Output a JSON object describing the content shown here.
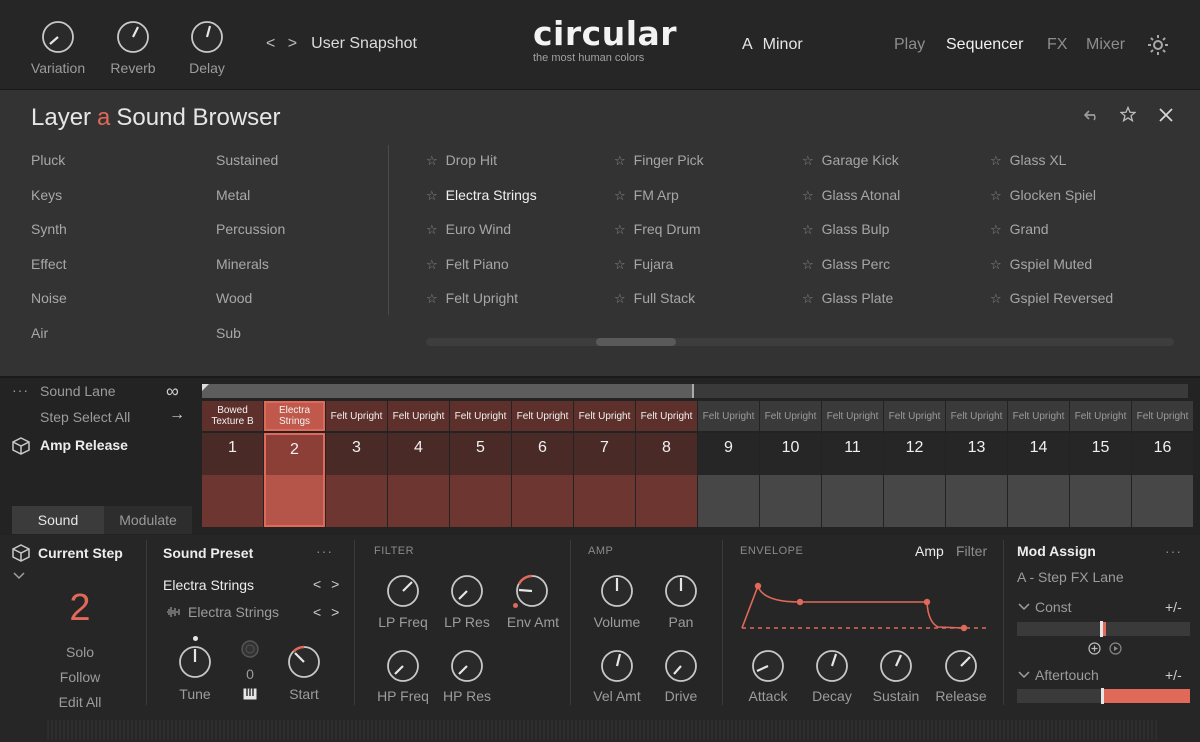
{
  "top": {
    "knobs": [
      {
        "label": "Variation"
      },
      {
        "label": "Reverb"
      },
      {
        "label": "Delay"
      }
    ],
    "snapshot_nav": "< >",
    "snapshot": "User Snapshot",
    "brand": "circular",
    "brand_sub": "the most human colors",
    "key_root": "A",
    "key_mode": "Minor",
    "nav": [
      "Play",
      "Sequencer",
      "FX",
      "Mixer"
    ],
    "nav_active": "Sequencer"
  },
  "browser": {
    "title_layer": "Layer",
    "title_a": "a",
    "title_rest": "Sound Browser",
    "categories_col1": [
      "Pluck",
      "Keys",
      "Synth",
      "Effect",
      "Noise",
      "Air"
    ],
    "categories_col2": [
      "Sustained",
      "Metal",
      "Percussion",
      "Minerals",
      "Wood",
      "Sub"
    ],
    "presets": [
      [
        "Drop Hit",
        "Electra Strings",
        "Euro Wind",
        "Felt Piano",
        "Felt Upright"
      ],
      [
        "Finger Pick",
        "FM Arp",
        "Freq Drum",
        "Fujara",
        "Full Stack"
      ],
      [
        "Garage Kick",
        "Glass Atonal",
        "Glass Bulp",
        "Glass Perc",
        "Glass Plate"
      ],
      [
        "Glass XL",
        "Glocken Spiel",
        "Grand",
        "Gspiel Muted",
        "Gspiel Reversed"
      ]
    ],
    "selected_preset": "Electra Strings",
    "star": "☆"
  },
  "sequencer": {
    "sound_lane": "Sound Lane",
    "step_select": "Step Select",
    "step_select_all": "All",
    "lane_name": "Amp Release",
    "dots": "···",
    "infinity": "∞",
    "arrow": "→",
    "steps": [
      {
        "num": "1",
        "sound": "Bowed Texture B",
        "level": 1.0,
        "active": true
      },
      {
        "num": "2",
        "sound": "Electra Strings",
        "level": 0.7,
        "active": true,
        "selected": true
      },
      {
        "num": "3",
        "sound": "Felt Upright",
        "level": 1.0,
        "active": true
      },
      {
        "num": "4",
        "sound": "Felt Upright",
        "level": 1.0,
        "active": true
      },
      {
        "num": "5",
        "sound": "Felt Upright",
        "level": 1.0,
        "active": true
      },
      {
        "num": "6",
        "sound": "Felt Upright",
        "level": 1.0,
        "active": true
      },
      {
        "num": "7",
        "sound": "Felt Upright",
        "level": 1.0,
        "active": true
      },
      {
        "num": "8",
        "sound": "Felt Upright",
        "level": 1.0,
        "active": true
      },
      {
        "num": "9",
        "sound": "Felt Upright",
        "level": 1.0,
        "active": false
      },
      {
        "num": "10",
        "sound": "Felt Upright",
        "level": 1.0,
        "active": false
      },
      {
        "num": "11",
        "sound": "Felt Upright",
        "level": 1.0,
        "active": false
      },
      {
        "num": "12",
        "sound": "Felt Upright",
        "level": 1.0,
        "active": false
      },
      {
        "num": "13",
        "sound": "Felt Upright",
        "level": 1.0,
        "active": false
      },
      {
        "num": "14",
        "sound": "Felt Upright",
        "level": 1.0,
        "active": false
      },
      {
        "num": "15",
        "sound": "Felt Upright",
        "level": 1.0,
        "active": false
      },
      {
        "num": "16",
        "sound": "Felt Upright",
        "level": 1.0,
        "active": false
      }
    ],
    "tabs": [
      "Sound",
      "Modulate"
    ]
  },
  "current": {
    "title": "Current Step",
    "step": "2",
    "solo": "Solo",
    "follow": "Follow",
    "edit_all": "Edit All"
  },
  "sound_preset": {
    "title": "Sound Preset",
    "dots": "···",
    "preset": "Electra Strings",
    "sample": "Electra Strings",
    "arrows": "< >",
    "tune": "Tune",
    "fine_value": "0",
    "start": "Start"
  },
  "filter": {
    "title": "FILTER",
    "labels": [
      "LP Freq",
      "LP Res",
      "Env Amt",
      "HP Freq",
      "HP Res"
    ]
  },
  "amp": {
    "title": "AMP",
    "labels": [
      "Volume",
      "Pan",
      "Vel Amt",
      "Drive"
    ]
  },
  "envelope": {
    "title": "ENVELOPE",
    "amp": "Amp",
    "filter": "Filter",
    "labels": [
      "Attack",
      "Decay",
      "Sustain",
      "Release"
    ]
  },
  "mod": {
    "title": "Mod Assign",
    "dots": "···",
    "target": "A - Step FX Lane",
    "sources": [
      {
        "name": "Const",
        "plusminus": "+/-",
        "value": 0.5
      },
      {
        "name": "Aftertouch",
        "plusminus": "+/-",
        "value": 0.5
      }
    ]
  },
  "colors": {
    "accent": "#e0695a",
    "step_active": "#6e3630",
    "step_active_top": "#4a2a27",
    "step_inactive": "#474747"
  }
}
